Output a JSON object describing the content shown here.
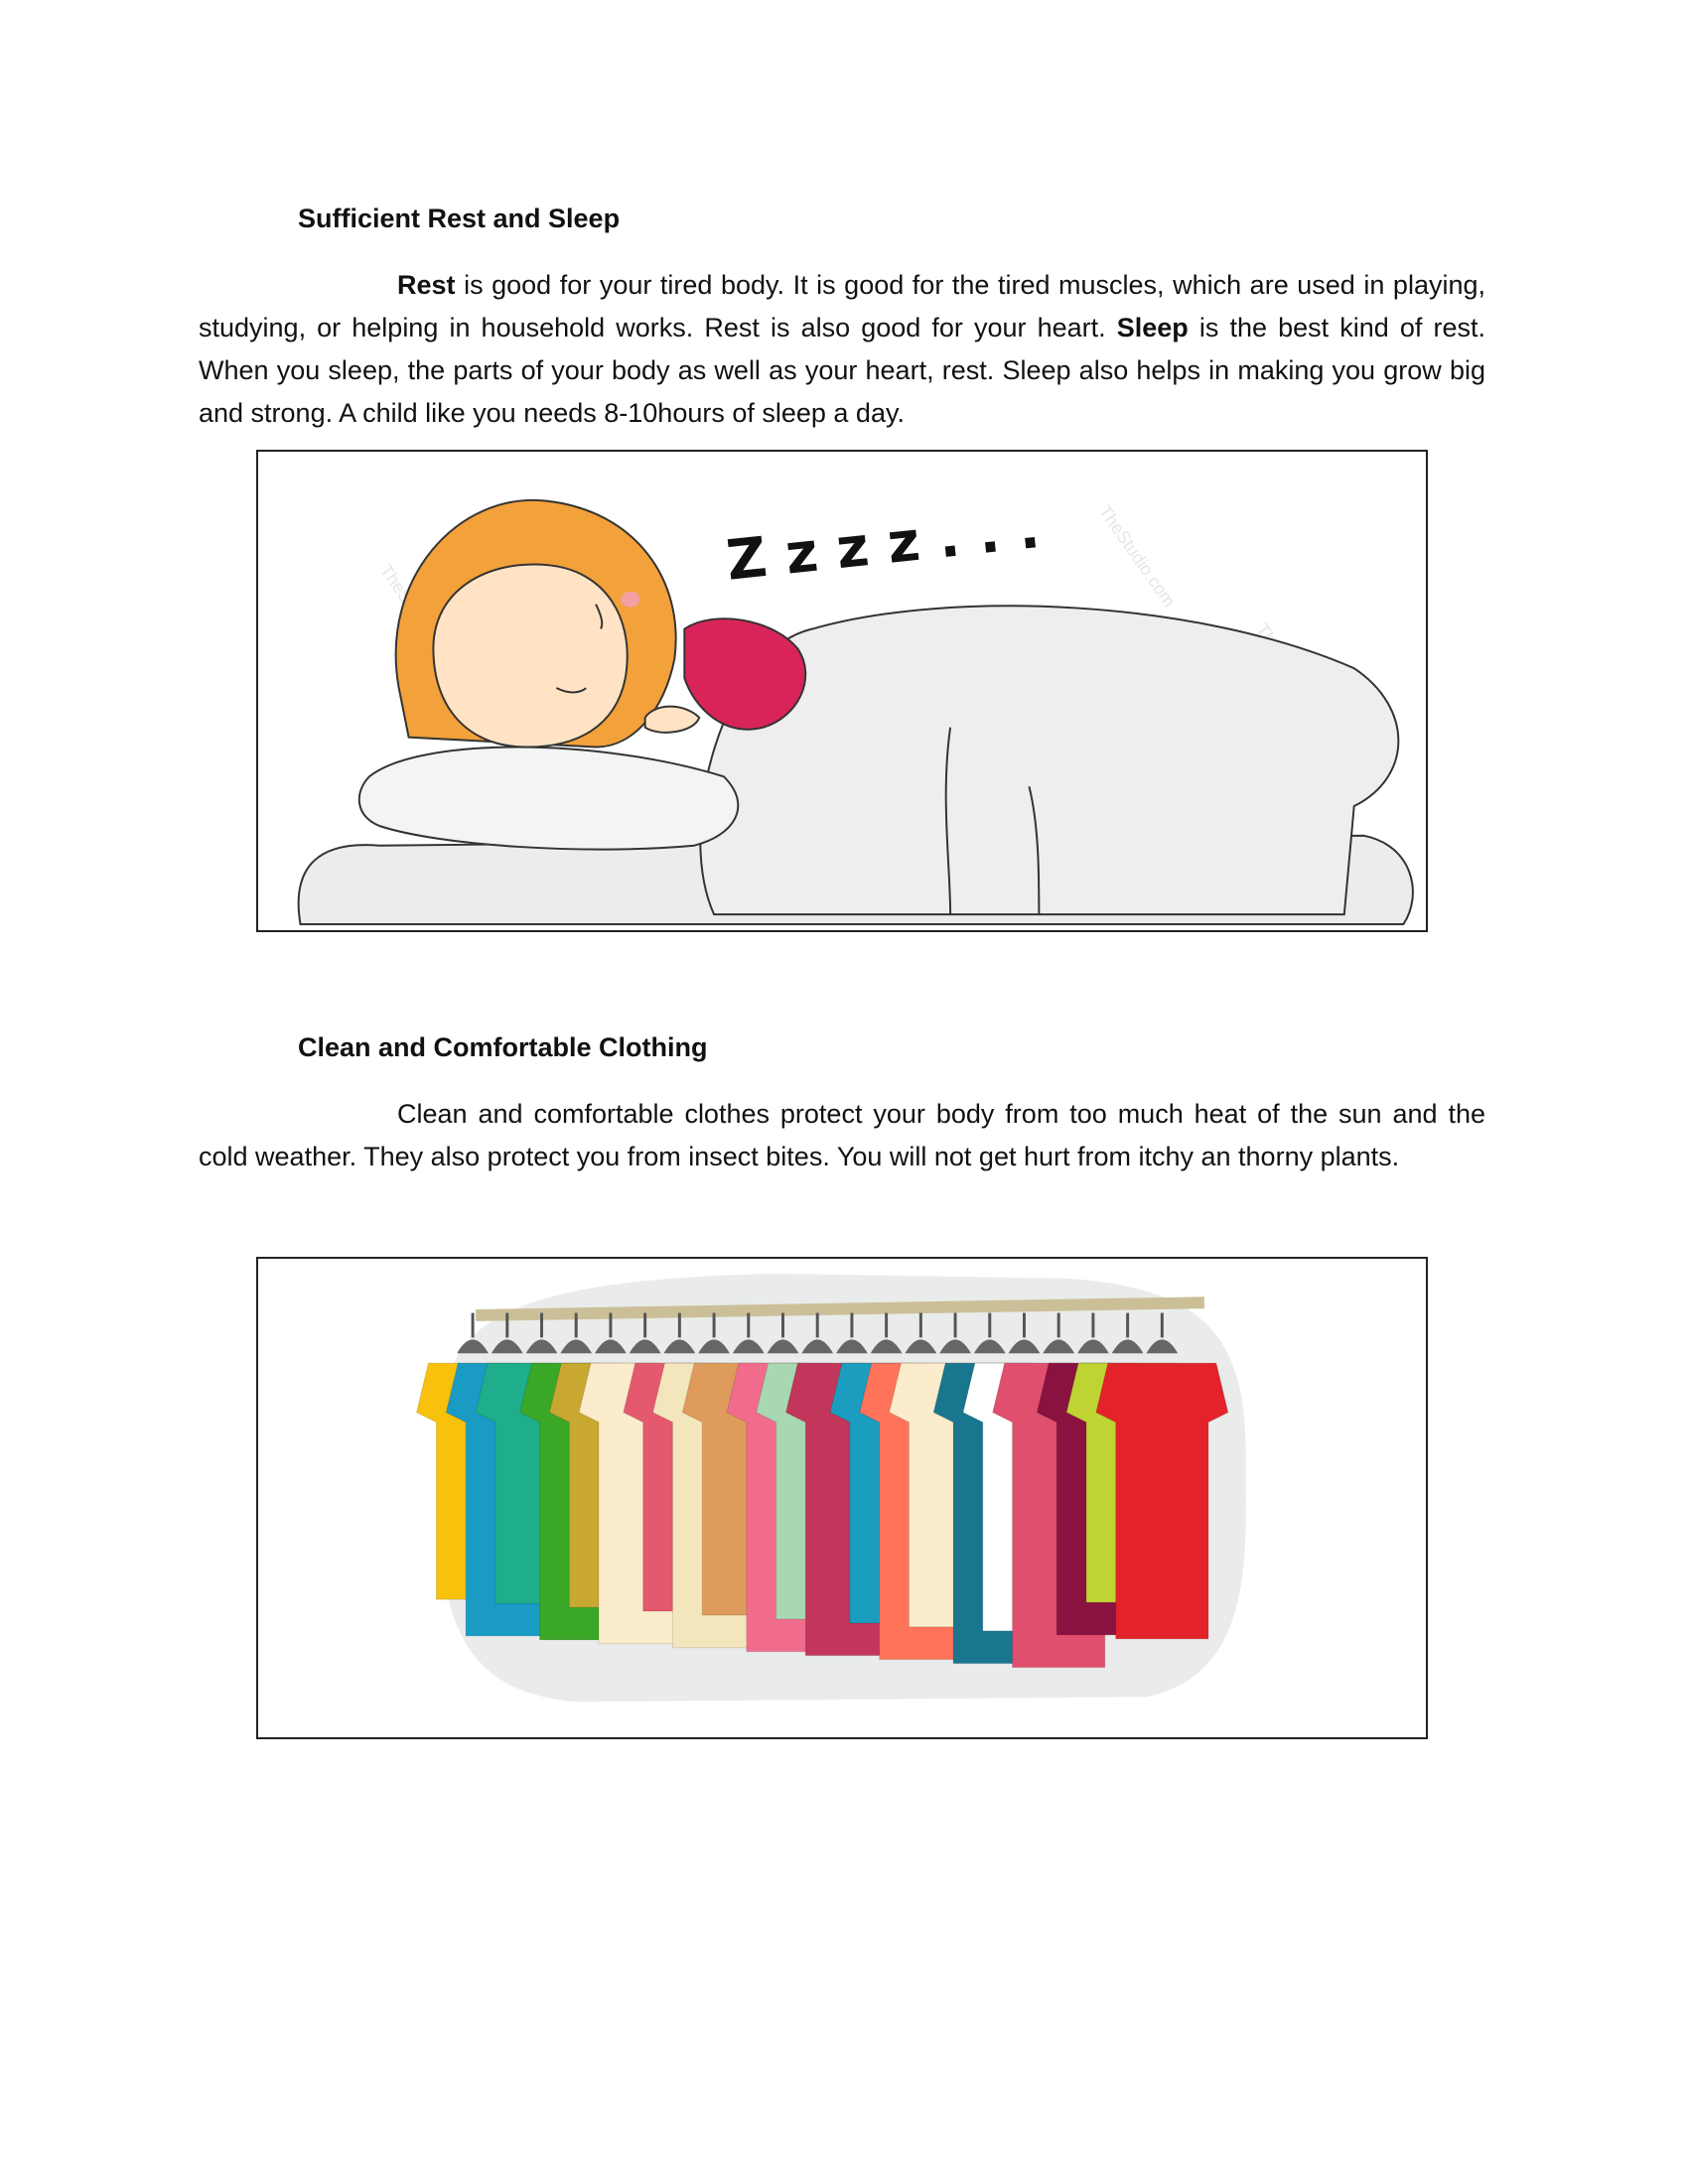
{
  "section1": {
    "heading": "Sufficient Rest and Sleep",
    "para_bold_rest": "Rest",
    "para_part1": " is good for your tired body. It is good for the tired muscles, which are used in playing, studying, or helping in household works. Rest is also good for your heart. ",
    "para_bold_sleep": "Sleep",
    "para_part2": " is the best kind of rest. When you sleep, the parts of your body as well as your heart, rest. Sleep also helps in making you grow big and strong. A child like you needs 8-10hours of sleep a day.",
    "image": {
      "zzz": "Z z z z . . .",
      "watermark": "TheStudio.com"
    }
  },
  "section2": {
    "heading": "Clean and Comfortable Clothing",
    "para": "Clean and comfortable clothes protect your body from too much heat of the sun and the cold weather. They also protect you from insect bites. You will not get hurt from itchy an thorny plants.",
    "image": {
      "shirt_colors": [
        "#f7c10c",
        "#1a9bc4",
        "#1fae8b",
        "#3aa826",
        "#c9a832",
        "#fbeccb",
        "#e4596e",
        "#f4e6bc",
        "#de9b5c",
        "#f16c8c",
        "#a7d8b2",
        "#c1365a",
        "#1b9dbf",
        "#ff735a",
        "#fbeccb",
        "#18778f",
        "#ffffff",
        "#e04f6d",
        "#8a1240",
        "#bfd432",
        "#e4222a"
      ]
    }
  }
}
